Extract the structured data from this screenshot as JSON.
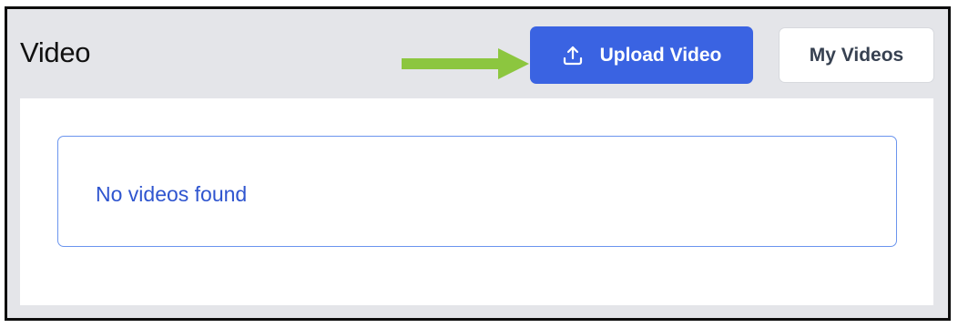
{
  "header": {
    "title": "Video"
  },
  "toolbar": {
    "upload_label": "Upload Video",
    "upload_icon": "upload-icon",
    "my_videos_label": "My Videos",
    "annotation_icon": "arrow-right-icon"
  },
  "main": {
    "empty_message": "No videos found"
  },
  "colors": {
    "primary": "#3a63e2",
    "annotation_arrow": "#8cc63f",
    "alert_border": "#6b95ee",
    "alert_text": "#2f55cf",
    "page_background": "#e4e5e9"
  }
}
